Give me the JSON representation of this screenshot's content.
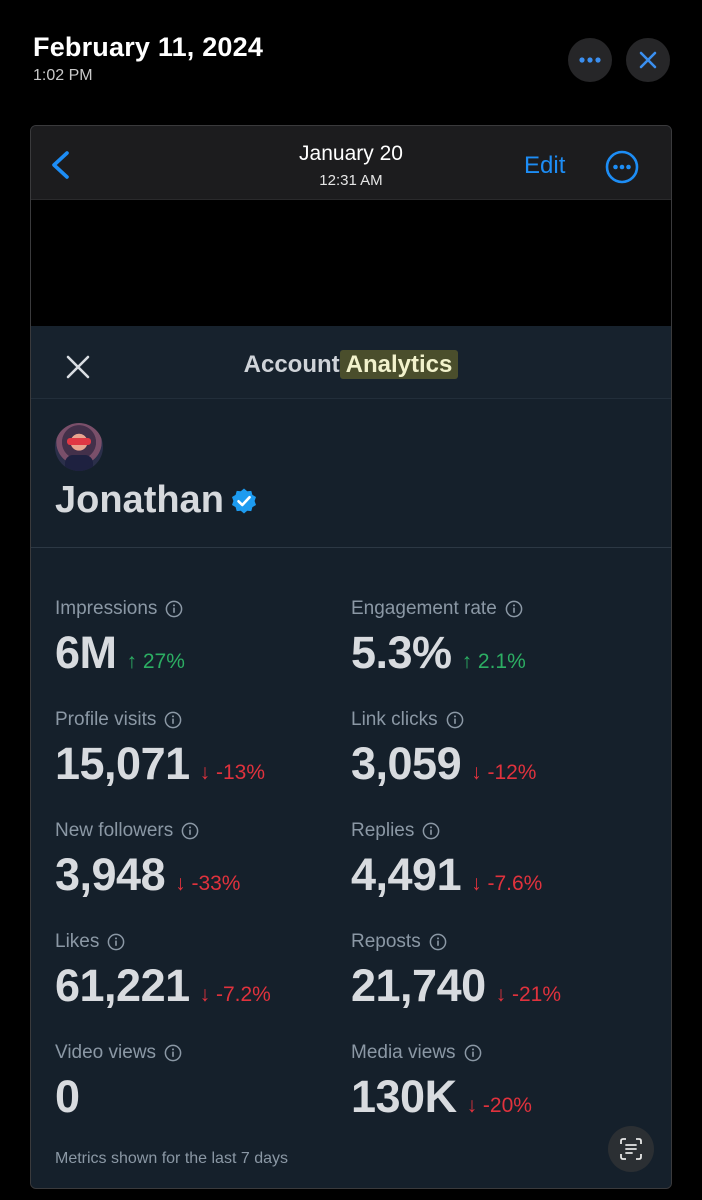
{
  "top": {
    "date": "February 11, 2024",
    "time": "1:02 PM",
    "more_icon": "ellipsis-icon",
    "close_icon": "close-icon"
  },
  "viewer": {
    "date": "January 20",
    "time": "12:31 AM",
    "edit_label": "Edit",
    "back_icon": "chevron-left-icon",
    "more_icon": "circle-ellipsis-icon"
  },
  "modal": {
    "title_part1": "Account",
    "title_part2": "Analytics",
    "close_icon": "x-icon"
  },
  "profile": {
    "name": "Jonathan",
    "verified_icon": "verified-badge-icon"
  },
  "metrics": [
    {
      "label": "Impressions",
      "value": "6M",
      "change": "↑ 27%",
      "direction": "up"
    },
    {
      "label": "Engagement rate",
      "value": "5.3%",
      "change": "↑ 2.1%",
      "direction": "up"
    },
    {
      "label": "Profile visits",
      "value": "15,071",
      "change": "↓ -13%",
      "direction": "down"
    },
    {
      "label": "Link clicks",
      "value": "3,059",
      "change": "↓ -12%",
      "direction": "down"
    },
    {
      "label": "New followers",
      "value": "3,948",
      "change": "↓ -33%",
      "direction": "down"
    },
    {
      "label": "Replies",
      "value": "4,491",
      "change": "↓ -7.6%",
      "direction": "down"
    },
    {
      "label": "Likes",
      "value": "61,221",
      "change": "↓ -7.2%",
      "direction": "down"
    },
    {
      "label": "Reposts",
      "value": "21,740",
      "change": "↓ -21%",
      "direction": "down"
    },
    {
      "label": "Video views",
      "value": "0",
      "change": "",
      "direction": "none"
    },
    {
      "label": "Media views",
      "value": "130K",
      "change": "↓ -20%",
      "direction": "down"
    }
  ],
  "footnote": "Metrics shown for the last 7 days",
  "colors": {
    "accent": "#1d8df5",
    "positive": "#2cae63",
    "negative": "#e0323d",
    "panel": "#15202b"
  }
}
